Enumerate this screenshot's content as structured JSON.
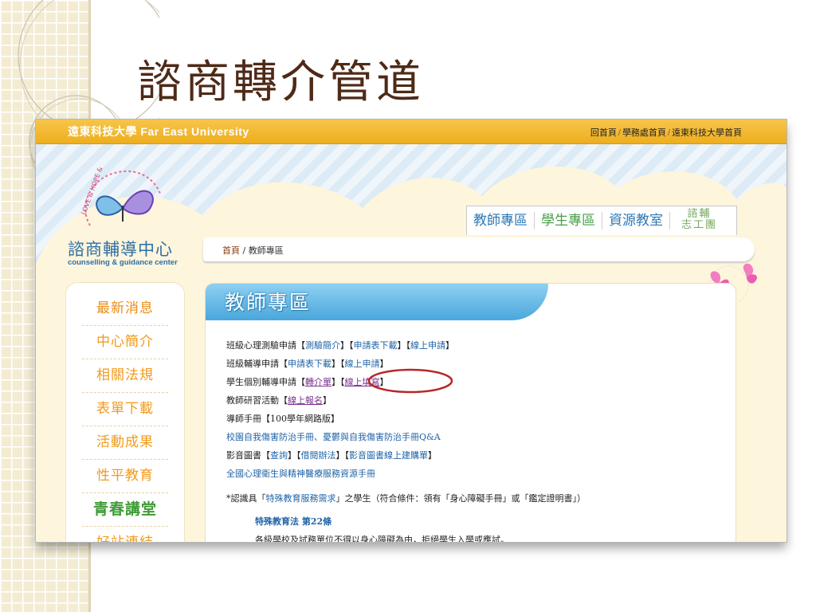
{
  "slide": {
    "title": "諮商轉介管道"
  },
  "site": {
    "title": "遠東科技大學 Far East University",
    "top_links": [
      "回首頁",
      "學務處首頁",
      "遠東科技大學首頁"
    ],
    "logo": {
      "cn": "諮商輔導中心",
      "en": "counselling & guidance center",
      "ring_text": "LOVE & HOPE & DREAM"
    }
  },
  "tabs": [
    {
      "label": "教師專區"
    },
    {
      "label": "學生專區"
    },
    {
      "label": "資源教室"
    },
    {
      "label_line1": "諮輔",
      "label_line2": "志工團"
    }
  ],
  "breadcrumb": {
    "home": "首頁",
    "sep": " / ",
    "current": "教師專區"
  },
  "menu": [
    "最新消息",
    "中心簡介",
    "相關法規",
    "表單下載",
    "活動成果",
    "性平教育",
    "青春講堂",
    "好站連結"
  ],
  "panel": {
    "title": "教師專區"
  },
  "content": {
    "row1": {
      "text": "班級心理測驗申請",
      "l1": "測驗簡介",
      "l2": "申請表下載",
      "l3": "線上申請"
    },
    "row2": {
      "text": "班級輔導申請",
      "l1": "申請表下載",
      "l2": "線上申請"
    },
    "row3": {
      "text": "學生個別輔導申請",
      "l1": "轉介單",
      "l2": "線上填寫"
    },
    "row4": {
      "text": "教師研習活動",
      "l1": "線上報名"
    },
    "row5": {
      "text": "導師手冊【100學年網路版】"
    },
    "row6": {
      "text": "校園自我傷害防治手冊、憂鬱與自我傷害防治手冊Q&A"
    },
    "row7": {
      "text": "影音圖書",
      "l1": "查詢",
      "l2": "借閱辦法",
      "l3": "影音圖書線上建購單"
    },
    "row8": {
      "text": "全國心理衛生與精神醫療服務資源手冊"
    },
    "row9": {
      "pre": "*認識具「",
      "link": "特殊教育服務需求",
      "post": "」之學生（符合條件：領有「身心障礙手冊」或「鑑定證明書」）"
    },
    "law_title": "特殊教育法 第22條",
    "law_text": "各級學校及試務單位不得以身心障礙為由，拒絕學生入學或應試。"
  }
}
